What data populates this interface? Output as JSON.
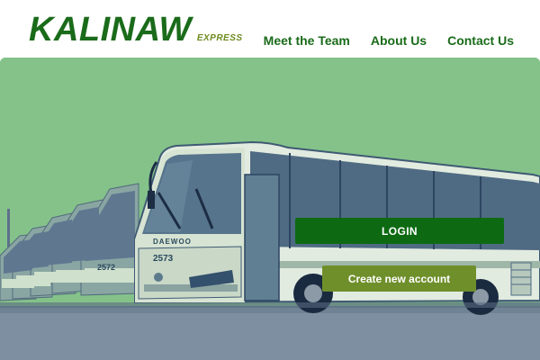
{
  "brand": {
    "name": "KALINAW",
    "sub": "EXPRESS"
  },
  "nav": [
    {
      "label": "Meet the Team"
    },
    {
      "label": "About Us"
    },
    {
      "label": "Contact Us"
    }
  ],
  "hero": {
    "bus_numbers": [
      "2573",
      "2572"
    ],
    "bus_brand": "DAEWOO"
  },
  "actions": {
    "login_label": "LOGIN",
    "create_label": "Create new account"
  },
  "colors": {
    "brand_green": "#1a6b1a",
    "accent_olive": "#6e8b1e",
    "hero_tint": "#84c28a",
    "login_button": "#0d6a12",
    "create_button": "#6f8f2b"
  }
}
